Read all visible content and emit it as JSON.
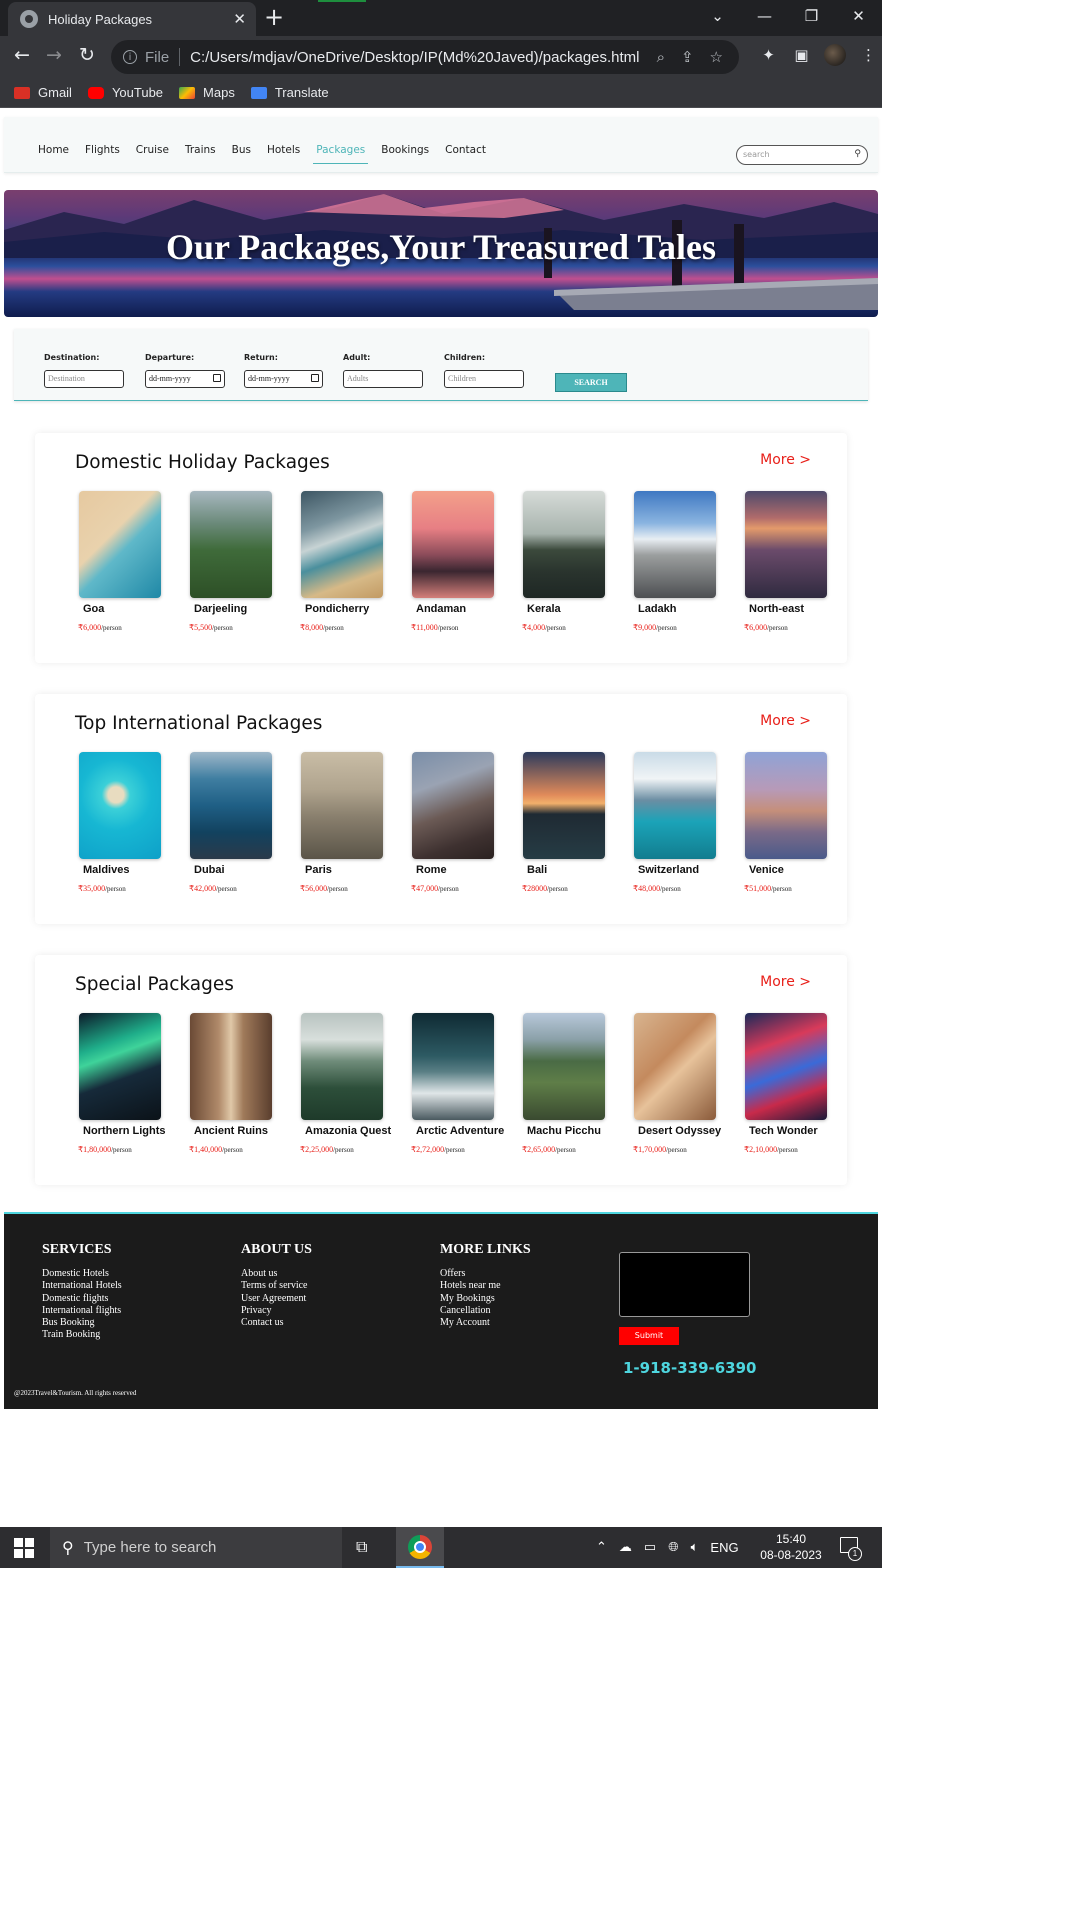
{
  "browser": {
    "tab_title": "Holiday Packages",
    "url_scheme": "File",
    "url": "C:/Users/mdjav/OneDrive/Desktop/IP(Md%20Javed)/packages.html",
    "bookmarks": [
      {
        "label": "Gmail",
        "icon": "gmail-icon",
        "color": "#d93025"
      },
      {
        "label": "YouTube",
        "icon": "youtube-icon",
        "color": "#ff0000"
      },
      {
        "label": "Maps",
        "icon": "maps-icon",
        "color": "#34a853"
      },
      {
        "label": "Translate",
        "icon": "translate-icon",
        "color": "#4285f4"
      }
    ]
  },
  "nav": {
    "items": [
      "Home",
      "Flights",
      "Cruise",
      "Trains",
      "Bus",
      "Hotels",
      "Packages",
      "Bookings",
      "Contact"
    ],
    "active": "Packages",
    "search_placeholder": "search"
  },
  "hero": {
    "title": "Our Packages,Your Treasured Tales"
  },
  "search_form": {
    "fields": [
      {
        "label": "Destination:",
        "placeholder": "Destination"
      },
      {
        "label": "Departure:",
        "placeholder": "dd-mm-yyyy"
      },
      {
        "label": "Return:",
        "placeholder": "dd-mm-yyyy"
      },
      {
        "label": "Adult:",
        "placeholder": "Adults"
      },
      {
        "label": "Children:",
        "placeholder": "Children"
      }
    ],
    "button": "SEARCH"
  },
  "sections": [
    {
      "title": "Domestic Holiday Packages",
      "more": "More >",
      "cards": [
        {
          "name": "Goa",
          "price": "₹6,000",
          "unit": "/person"
        },
        {
          "name": "Darjeeling",
          "price": "₹5,500",
          "unit": "/person"
        },
        {
          "name": "Pondicherry",
          "price": "₹8,000",
          "unit": "/person"
        },
        {
          "name": "Andaman",
          "price": "₹11,000",
          "unit": "/person"
        },
        {
          "name": "Kerala",
          "price": "₹4,000",
          "unit": "/person"
        },
        {
          "name": "Ladakh",
          "price": "₹9,000",
          "unit": "/person"
        },
        {
          "name": "North-east",
          "price": "₹6,000",
          "unit": "/person"
        }
      ]
    },
    {
      "title": "Top International Packages",
      "more": "More >",
      "cards": [
        {
          "name": "Maldives",
          "price": "₹35,000",
          "unit": "/person"
        },
        {
          "name": "Dubai",
          "price": "₹42,000",
          "unit": "/person"
        },
        {
          "name": "Paris",
          "price": "₹56,000",
          "unit": "/person"
        },
        {
          "name": "Rome",
          "price": "₹47,000",
          "unit": "/person"
        },
        {
          "name": "Bali",
          "price": "₹28000",
          "unit": "/person"
        },
        {
          "name": "Switzerland",
          "price": "₹48,000",
          "unit": "/person"
        },
        {
          "name": "Venice",
          "price": "₹51,000",
          "unit": "/person"
        }
      ]
    },
    {
      "title": "Special Packages",
      "more": "More >",
      "cards": [
        {
          "name": "Northern Lights",
          "price": "₹1,80,000",
          "unit": "/person"
        },
        {
          "name": "Ancient Ruins",
          "price": "₹1,40,000",
          "unit": "/person"
        },
        {
          "name": "Amazonia Quest",
          "price": "₹2,25,000",
          "unit": "/person"
        },
        {
          "name": "Arctic Adventure",
          "price": "₹2,72,000",
          "unit": "/person"
        },
        {
          "name": "Machu Picchu",
          "price": "₹2,65,000",
          "unit": "/person"
        },
        {
          "name": "Desert Odyssey",
          "price": "₹1,70,000",
          "unit": "/person"
        },
        {
          "name": "Tech Wonder",
          "price": "₹2,10,000",
          "unit": "/person"
        }
      ]
    }
  ],
  "footer": {
    "services": {
      "heading": "SERVICES",
      "links": [
        "Domestic Hotels",
        "International Hotels",
        "Domestic flights",
        "International flights",
        "Bus Booking",
        "Train Booking"
      ]
    },
    "about": {
      "heading": "ABOUT US",
      "links": [
        "About us",
        "Terms of service",
        "User Agreement",
        "Privacy",
        "Contact us"
      ]
    },
    "more_links": {
      "heading": "MORE LINKS",
      "links": [
        "Offers",
        "Hotels near me",
        "My Bookings",
        "Cancellation",
        "My Account"
      ]
    },
    "submit": "Submit",
    "phone": "1-918-339-6390",
    "copyright": "@2023Travel&Tourism. All rights reserved"
  },
  "taskbar": {
    "search_text": "Type here to search",
    "lang": "ENG",
    "time": "15:40",
    "date": "08-08-2023",
    "notification_count": "1"
  }
}
